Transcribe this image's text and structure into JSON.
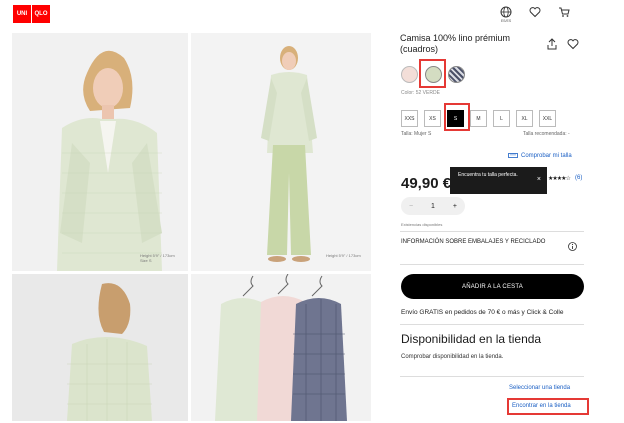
{
  "header": {
    "logo_lines": [
      "UNI",
      "QLO",
      "ユニ",
      "クロ"
    ],
    "lang_label": "ES/ES"
  },
  "gallery": {
    "captions": [
      "Height 5'9\" / 173cm\nSize S",
      "Height 5'9\" / 173cm"
    ]
  },
  "product": {
    "title": "Camisa 100% lino prémium (cuadros)",
    "color_label": "Color: 52 VERDE",
    "sizes": [
      "XXS",
      "XS",
      "S",
      "M",
      "L",
      "XL",
      "XXL"
    ],
    "selected_size": "S",
    "size_label": "Talla: Mujer S",
    "size_recommended": "Talla recomendada: -",
    "compare_link": "Comprobar mi talla",
    "tooltip_text": "Encuentra tu talla perfecta.",
    "tooltip_close": "×",
    "price": "49,90 €",
    "stars": "★★★★☆",
    "reviews": "(6)",
    "quantity": "1",
    "qty_minus": "−",
    "qty_plus": "+",
    "stock": "Existencias disponibles",
    "packaging": "INFORMACIÓN SOBRE EMBALAJES Y RECICLADO",
    "add_to_cart": "AÑADIR A LA CESTA",
    "shipping": "Envío GRATIS en pedidos de 70 € o más y Click & Colle",
    "availability_title": "Disponibilidad en la tienda",
    "availability_desc": "Comprobar disponibilidad en la tienda.",
    "select_store": "Seleccionar una tienda",
    "find_store": "Encontrar en la tienda"
  },
  "colors": {
    "brand": "#ff0000",
    "link": "#1a5fc4",
    "highlight": "#e53935"
  }
}
